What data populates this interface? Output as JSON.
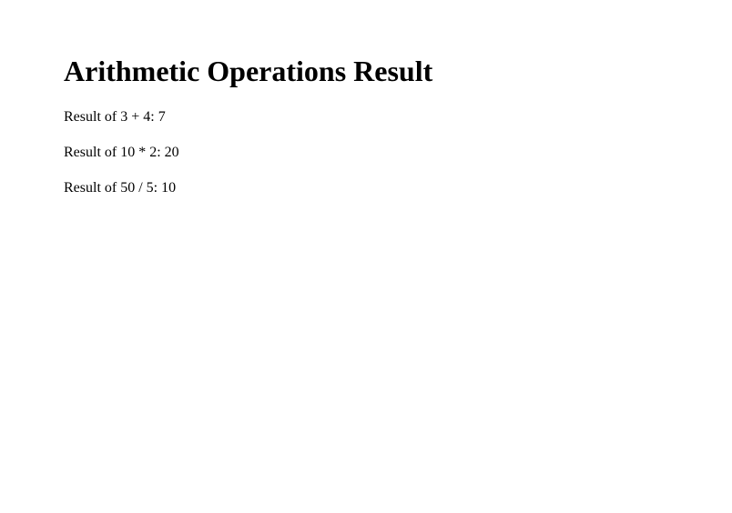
{
  "heading": "Arithmetic Operations Result",
  "results": {
    "line1": "Result of 3 + 4: 7",
    "line2": "Result of 10 * 2: 20",
    "line3": "Result of 50 / 5: 10"
  }
}
